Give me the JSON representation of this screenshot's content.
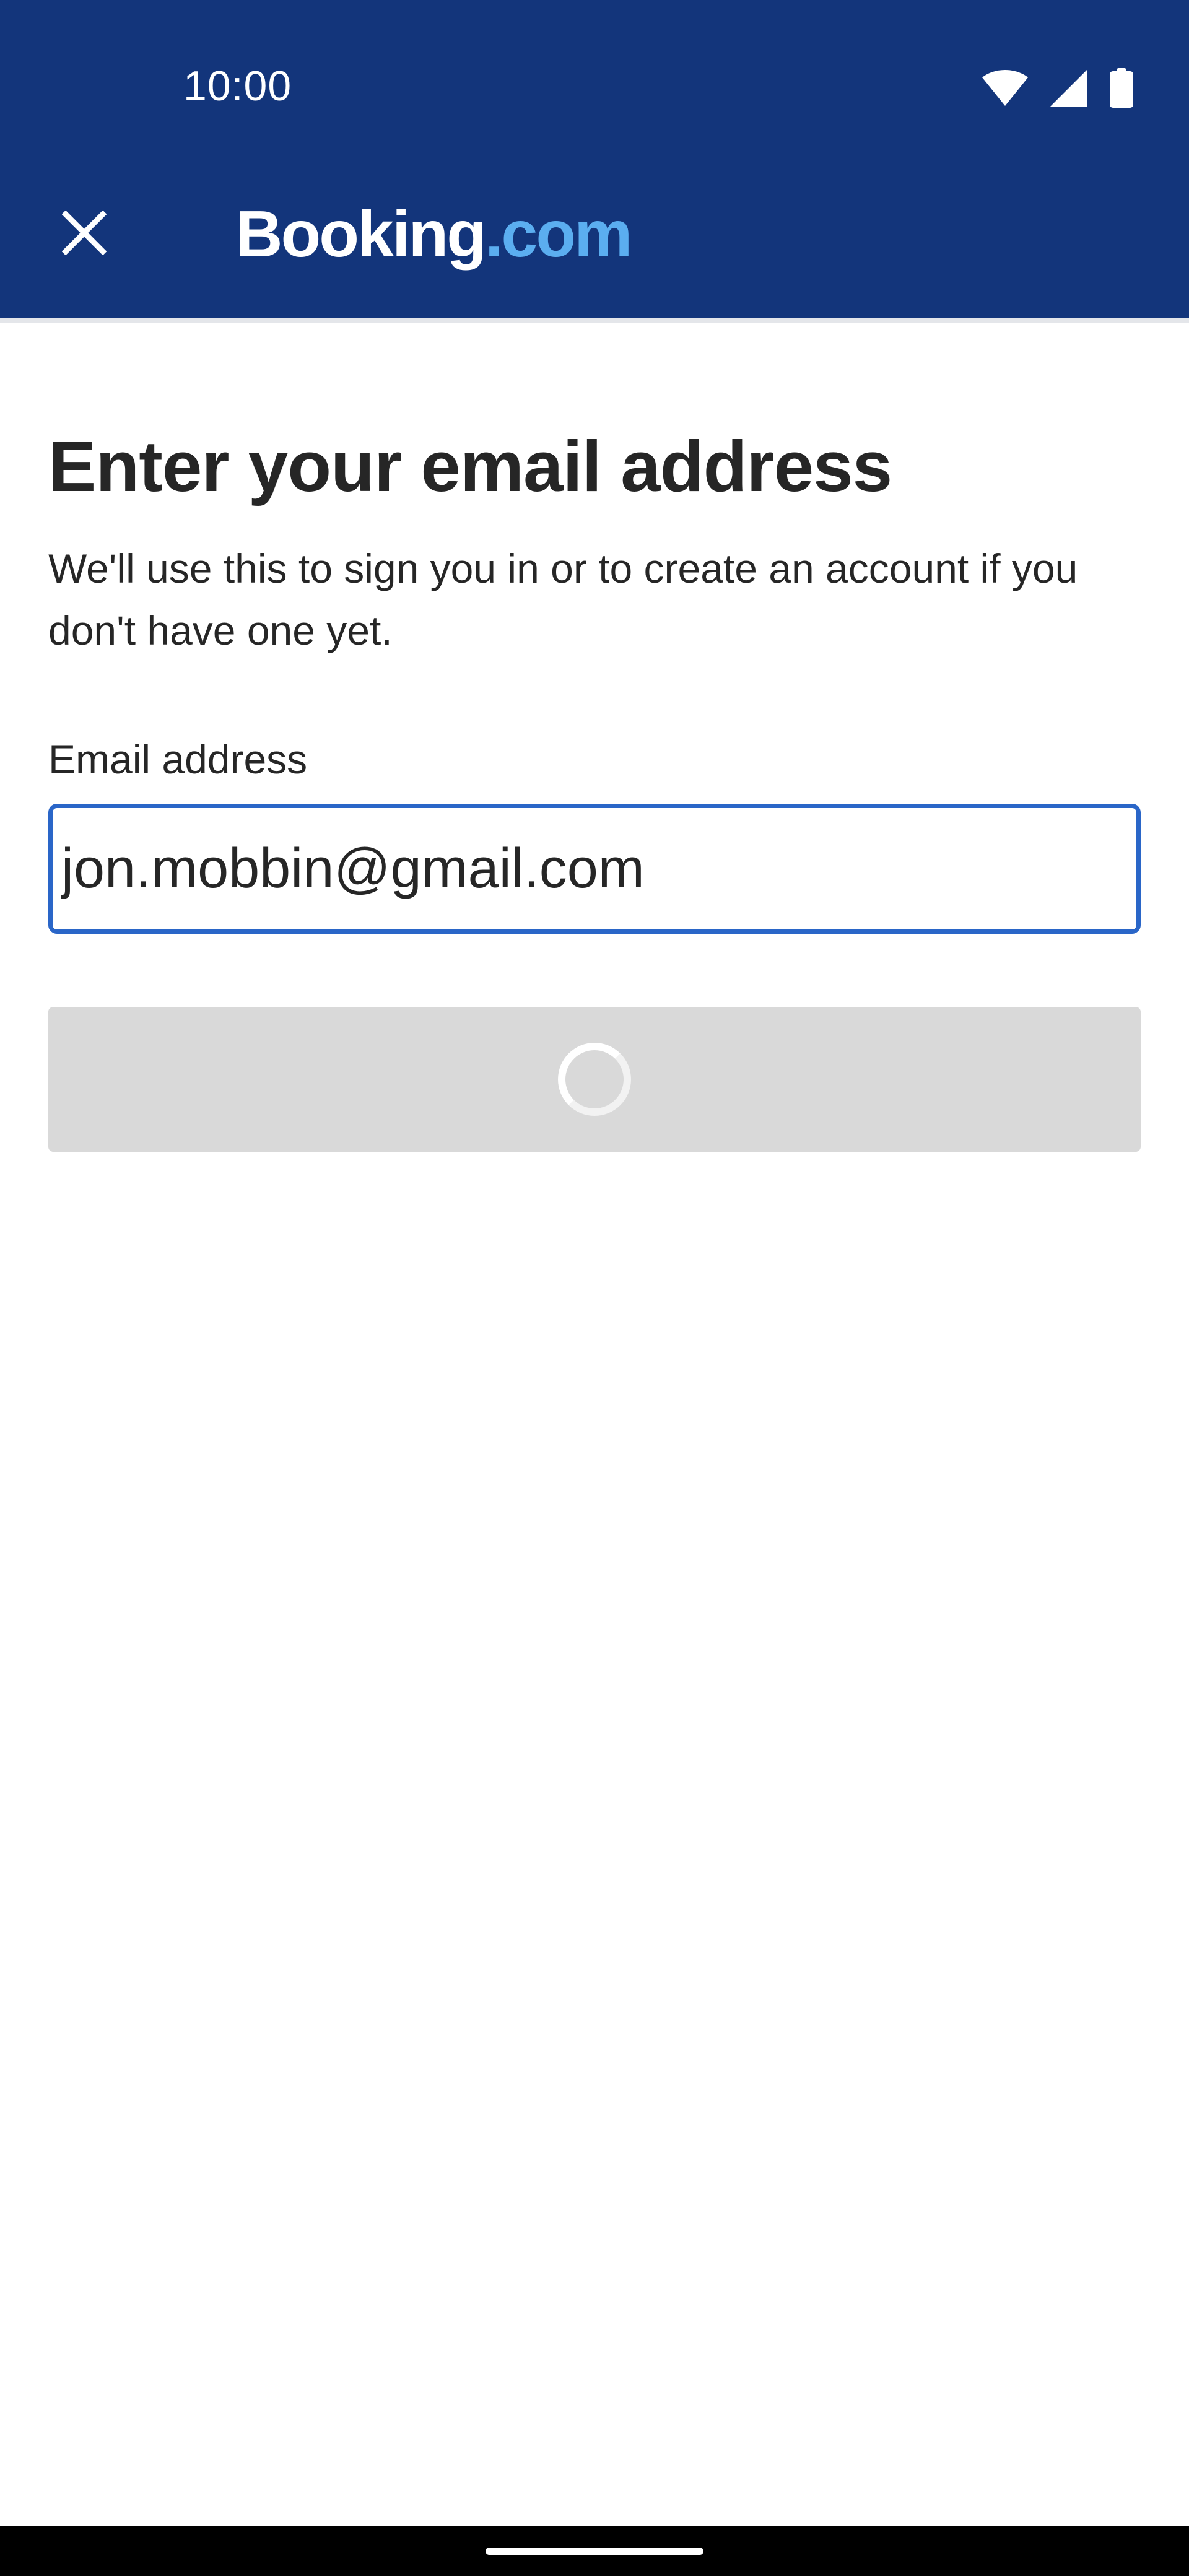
{
  "status_bar": {
    "time": "10:00",
    "icons": [
      "wifi-icon",
      "cellular-signal-icon",
      "battery-icon"
    ]
  },
  "app_bar": {
    "close_icon": "close-icon",
    "logo_main": "Booking",
    "logo_suffix": ".com"
  },
  "content": {
    "title": "Enter your email address",
    "subtitle": "We'll use this to sign you in or to create an account if you don't have one yet.",
    "email_label": "Email address",
    "email_value": "jon.mobbin@gmail.com",
    "continue_state": "loading-spinner"
  },
  "colors": {
    "header_bg": "#13357b",
    "logo_accent": "#5baef0",
    "input_border": "#2a66c8",
    "button_disabled_bg": "#d9d9d9",
    "text_primary": "#262626"
  }
}
